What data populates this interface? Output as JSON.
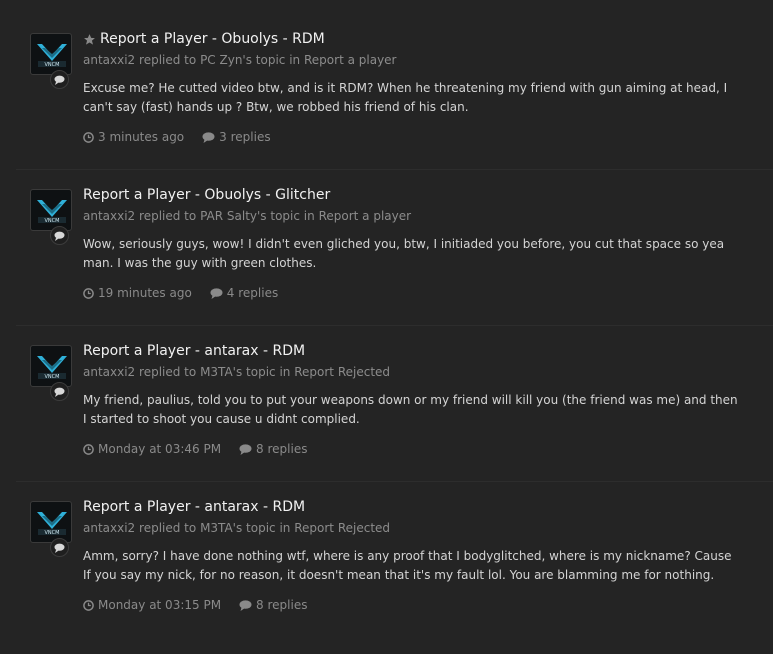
{
  "activity": [
    {
      "title": "Report a Player - Obuolys - RDM",
      "starred": true,
      "author": "antaxxi2",
      "replied_to_text": "replied to",
      "topic_owner": "PC Zyn's topic",
      "in_text": "in",
      "forum": "Report a player",
      "snippet": "Excuse me? He cutted video btw, and is it RDM? When he threatening my friend with gun aiming at head, I can't say (fast) hands up ? Btw, we robbed his friend of his clan.",
      "time": "3 minutes ago",
      "replies": "3 replies"
    },
    {
      "title": "Report a Player - Obuolys - Glitcher",
      "starred": false,
      "author": "antaxxi2",
      "replied_to_text": "replied to",
      "topic_owner": "PAR Salty's topic",
      "in_text": "in",
      "forum": "Report a player",
      "snippet": "Wow, seriously guys, wow! I didn't even gliched you, btw, I initiaded you before, you cut that space so yea man. I was the guy with green clothes.",
      "time": "19 minutes ago",
      "replies": "4 replies"
    },
    {
      "title": "Report a Player - antarax - RDM",
      "starred": false,
      "author": "antaxxi2",
      "replied_to_text": "replied to",
      "topic_owner": "M3TA's topic",
      "in_text": "in",
      "forum": "Report Rejected",
      "snippet": "My friend, paulius, told you to put your weapons down or my friend will kill you (the friend was me) and then I started to shoot you cause u didnt complied.",
      "time": "Monday at 03:46 PM",
      "replies": "8 replies"
    },
    {
      "title": "Report a Player - antarax - RDM",
      "starred": false,
      "author": "antaxxi2",
      "replied_to_text": "replied to",
      "topic_owner": "M3TA's topic",
      "in_text": "in",
      "forum": "Report Rejected",
      "snippet": "Amm, sorry? I have done nothing wtf, where is any proof that I bodyglitched, where is my nickname? Cause If you say my nick, for no reason, it doesn't mean that it's my fault lol. You are blamming me for nothing.",
      "time": "Monday at 03:15 PM",
      "replies": "8 replies"
    }
  ],
  "icons": {
    "star": "star-icon",
    "clock": "clock-icon",
    "comment": "comment-icon",
    "avatar_logo": "v-logo-avatar"
  },
  "colors": {
    "background": "#242424",
    "avatar_accent": "#2fb0d8",
    "title": "#f1f1f1",
    "muted": "#8c8c8c"
  }
}
